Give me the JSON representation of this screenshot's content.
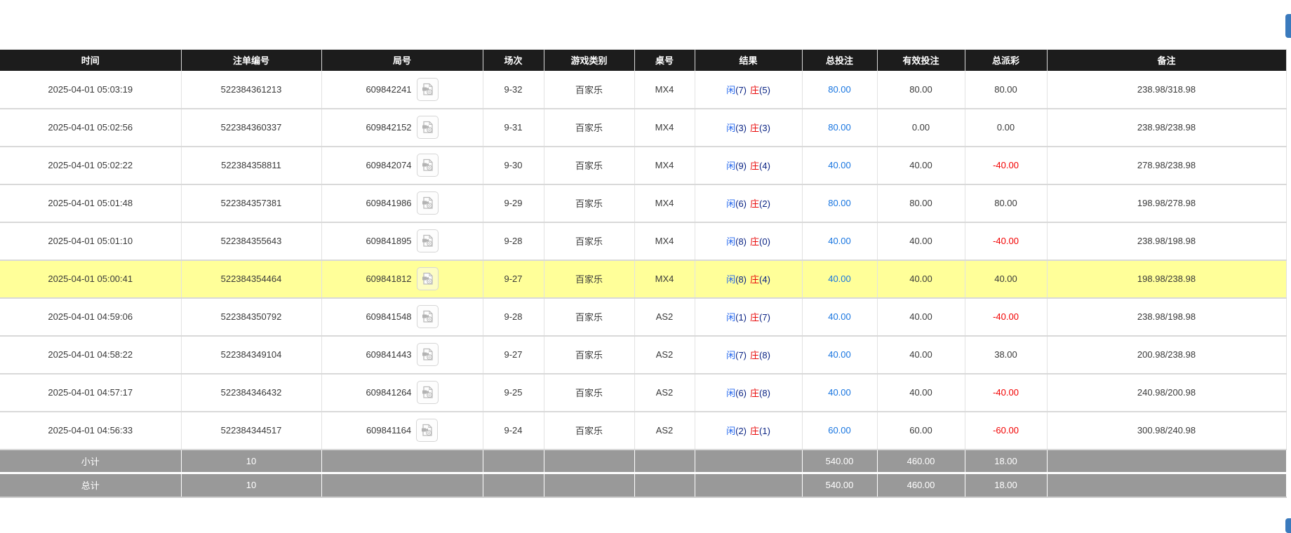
{
  "colors": {
    "header_bg": "#1c1c1c",
    "summary_bg": "#999999",
    "highlight_row": "#ffff99",
    "link_blue": "#1674e0",
    "player_blue": "#2567ee",
    "banker_red": "#e80b0b",
    "negative_red": "#f20000",
    "edge_button_blue": "#3a7abd"
  },
  "icons": {
    "round_video": "video-file-icon"
  },
  "table": {
    "columns": {
      "time": "时间",
      "bet_no": "注单编号",
      "round_no": "局号",
      "session": "场次",
      "game_type": "游戏类别",
      "table_no": "桌号",
      "result": "结果",
      "total_bet": "总投注",
      "valid_bet": "有效投注",
      "payout": "总派彩",
      "remark": "备注"
    },
    "rows": [
      {
        "time": "2025-04-01 05:03:19",
        "bet_no": "522384361213",
        "round_no": "609842241",
        "session": "9-32",
        "game": "百家乐",
        "table_no": "MX4",
        "player": "闲",
        "player_score": "(7)",
        "banker": "庄",
        "banker_score": "(5)",
        "total_bet": "80.00",
        "valid_bet": "80.00",
        "payout": "80.00",
        "remark": "238.98/318.98"
      },
      {
        "time": "2025-04-01 05:02:56",
        "bet_no": "522384360337",
        "round_no": "609842152",
        "session": "9-31",
        "game": "百家乐",
        "table_no": "MX4",
        "player": "闲",
        "player_score": "(3)",
        "banker": "庄",
        "banker_score": "(3)",
        "total_bet": "80.00",
        "valid_bet": "0.00",
        "payout": "0.00",
        "remark": "238.98/238.98"
      },
      {
        "time": "2025-04-01 05:02:22",
        "bet_no": "522384358811",
        "round_no": "609842074",
        "session": "9-30",
        "game": "百家乐",
        "table_no": "MX4",
        "player": "闲",
        "player_score": "(9)",
        "banker": "庄",
        "banker_score": "(4)",
        "total_bet": "40.00",
        "valid_bet": "40.00",
        "payout": "-40.00",
        "remark": "278.98/238.98"
      },
      {
        "time": "2025-04-01 05:01:48",
        "bet_no": "522384357381",
        "round_no": "609841986",
        "session": "9-29",
        "game": "百家乐",
        "table_no": "MX4",
        "player": "闲",
        "player_score": "(6)",
        "banker": "庄",
        "banker_score": "(2)",
        "total_bet": "80.00",
        "valid_bet": "80.00",
        "payout": "80.00",
        "remark": "198.98/278.98"
      },
      {
        "time": "2025-04-01 05:01:10",
        "bet_no": "522384355643",
        "round_no": "609841895",
        "session": "9-28",
        "game": "百家乐",
        "table_no": "MX4",
        "player": "闲",
        "player_score": "(8)",
        "banker": "庄",
        "banker_score": "(0)",
        "total_bet": "40.00",
        "valid_bet": "40.00",
        "payout": "-40.00",
        "remark": "238.98/198.98"
      },
      {
        "time": "2025-04-01 05:00:41",
        "bet_no": "522384354464",
        "round_no": "609841812",
        "session": "9-27",
        "game": "百家乐",
        "table_no": "MX4",
        "player": "闲",
        "player_score": "(8)",
        "banker": "庄",
        "banker_score": "(4)",
        "total_bet": "40.00",
        "valid_bet": "40.00",
        "payout": "40.00",
        "remark": "198.98/238.98"
      },
      {
        "time": "2025-04-01 04:59:06",
        "bet_no": "522384350792",
        "round_no": "609841548",
        "session": "9-28",
        "game": "百家乐",
        "table_no": "AS2",
        "player": "闲",
        "player_score": "(1)",
        "banker": "庄",
        "banker_score": "(7)",
        "total_bet": "40.00",
        "valid_bet": "40.00",
        "payout": "-40.00",
        "remark": "238.98/198.98"
      },
      {
        "time": "2025-04-01 04:58:22",
        "bet_no": "522384349104",
        "round_no": "609841443",
        "session": "9-27",
        "game": "百家乐",
        "table_no": "AS2",
        "player": "闲",
        "player_score": "(7)",
        "banker": "庄",
        "banker_score": "(8)",
        "total_bet": "40.00",
        "valid_bet": "40.00",
        "payout": "38.00",
        "remark": "200.98/238.98"
      },
      {
        "time": "2025-04-01 04:57:17",
        "bet_no": "522384346432",
        "round_no": "609841264",
        "session": "9-25",
        "game": "百家乐",
        "table_no": "AS2",
        "player": "闲",
        "player_score": "(6)",
        "banker": "庄",
        "banker_score": "(8)",
        "total_bet": "40.00",
        "valid_bet": "40.00",
        "payout": "-40.00",
        "remark": "240.98/200.98"
      },
      {
        "time": "2025-04-01 04:56:33",
        "bet_no": "522384344517",
        "round_no": "609841164",
        "session": "9-24",
        "game": "百家乐",
        "table_no": "AS2",
        "player": "闲",
        "player_score": "(2)",
        "banker": "庄",
        "banker_score": "(1)",
        "total_bet": "60.00",
        "valid_bet": "60.00",
        "payout": "-60.00",
        "remark": "300.98/240.98"
      }
    ],
    "subtotal": {
      "label": "小计",
      "count": "10",
      "total_bet": "540.00",
      "valid_bet": "460.00",
      "payout": "18.00"
    },
    "total": {
      "label": "总计",
      "count": "10",
      "total_bet": "540.00",
      "valid_bet": "460.00",
      "payout": "18.00"
    }
  }
}
